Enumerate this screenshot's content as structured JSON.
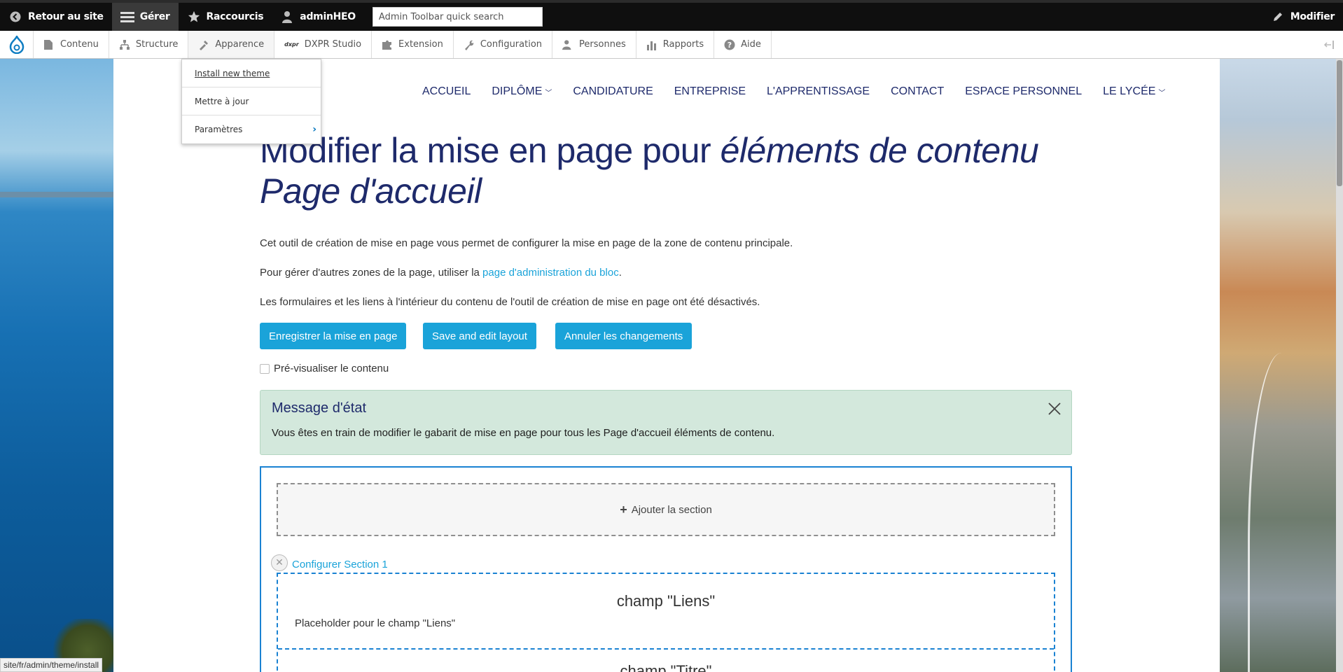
{
  "toolbar": {
    "back_label": "Retour au site",
    "manage_label": "Gérer",
    "shortcuts_label": "Raccourcis",
    "user_label": "adminHEO",
    "search_placeholder": "Admin Toolbar quick search",
    "edit_label": "Modifier"
  },
  "tray": {
    "items": [
      {
        "label": "Contenu"
      },
      {
        "label": "Structure"
      },
      {
        "label": "Apparence"
      },
      {
        "label": "DXPR Studio"
      },
      {
        "label": "Extension"
      },
      {
        "label": "Configuration"
      },
      {
        "label": "Personnes"
      },
      {
        "label": "Rapports"
      },
      {
        "label": "Aide"
      }
    ],
    "dxpr_badge": "dxpr"
  },
  "dropdown": {
    "items": [
      {
        "label": "Install new theme"
      },
      {
        "label": "Mettre à jour"
      },
      {
        "label": "Paramètres"
      }
    ]
  },
  "site_nav": {
    "items": [
      "ACCUEIL",
      "DIPLÔME",
      "CANDIDATURE",
      "ENTREPRISE",
      "L'APPRENTISSAGE",
      "CONTACT",
      "ESPACE PERSONNEL",
      "LE LYCÉE"
    ]
  },
  "page": {
    "title_main": "Modifier la mise en page pour ",
    "title_em1": "éléments de contenu",
    "title_em2": "Page d'accueil",
    "para1": "Cet outil de création de mise en page vous permet de configurer la mise en page de la zone de contenu principale.",
    "para2_before": "Pour gérer d'autres zones de la page, utiliser la ",
    "para2_link": "page d'administration du bloc",
    "para2_after": ".",
    "para3": "Les formulaires et les liens à l'intérieur du contenu de l'outil de création de mise en page ont été désactivés.",
    "btn_save": "Enregistrer la mise en page",
    "btn_save_edit": "Save and edit layout",
    "btn_cancel": "Annuler les changements",
    "preview_label": "Pré-visualiser le contenu"
  },
  "message": {
    "title": "Message d'état",
    "text": "Vous êtes en train de modifier le gabarit de mise en page pour tous les Page d'accueil éléments de contenu."
  },
  "layout_builder": {
    "add_section": "Ajouter la section",
    "configure_section": "Configurer Section 1",
    "block1_title": "champ \"Liens\"",
    "block1_text": "Placeholder pour le champ \"Liens\"",
    "block2_title": "champ \"Titre\""
  },
  "status_bar": {
    "url": "site/fr/admin/theme/install"
  },
  "colors": {
    "accent": "#1aa3d9",
    "heading": "#1e2a6b",
    "message_bg": "#d3e8dc",
    "layout_border": "#1a82d2"
  }
}
